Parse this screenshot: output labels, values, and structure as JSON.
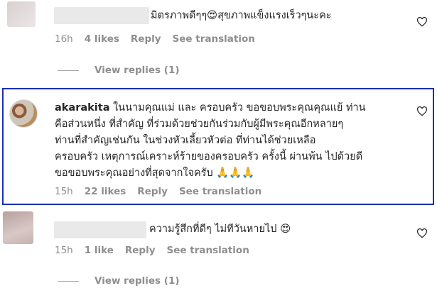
{
  "comments": [
    {
      "text": "มิตรภาพดีๆๆ😍สุขภาพแข็งแรงเร็วๆนะคะ",
      "time": "16h",
      "likes": "4 likes",
      "reply": "Reply",
      "translate": "See translation"
    },
    {
      "username": "akarakita",
      "lines": [
        "ในนามคุณแม่ และ ครอบครัว ขอขอบพระคุณคุณแย้ ท่าน",
        "คือส่วนหนึ่ง ที่สำคัญ ที่ร่วมด้วยช่วยกันร่วมกับผู้มีพระคุณอีกหลายๆ",
        "ท่านที่สำคัญเช่นกัน ในช่วงหัวเลี้ยวหัวต่อ ที่ท่านได้ช่วยเหลือ",
        "ครอบครัว เหตุการณ์เคราะห์ร้ายของครอบครัว ครั้งนี้ ผ่านพ้น ไปด้วยดี",
        "ขอขอบพระคุณอย่างที่สุดจากใจครับ 🙏🙏🙏"
      ],
      "time": "15h",
      "likes": "22 likes",
      "reply": "Reply",
      "translate": "See translation"
    },
    {
      "text": "ความรู้สึกที่ดีๆ ไม่ทีวันหายไป 😍",
      "time": "15h",
      "likes": "1 like",
      "reply": "Reply",
      "translate": "See translation"
    }
  ],
  "view_replies": [
    "View replies (1)",
    "View replies (1)"
  ],
  "colors": {
    "highlight": "#1b2fb5",
    "muted": "#8e8e8e"
  },
  "icons": {
    "like": "heart-outline-icon"
  }
}
